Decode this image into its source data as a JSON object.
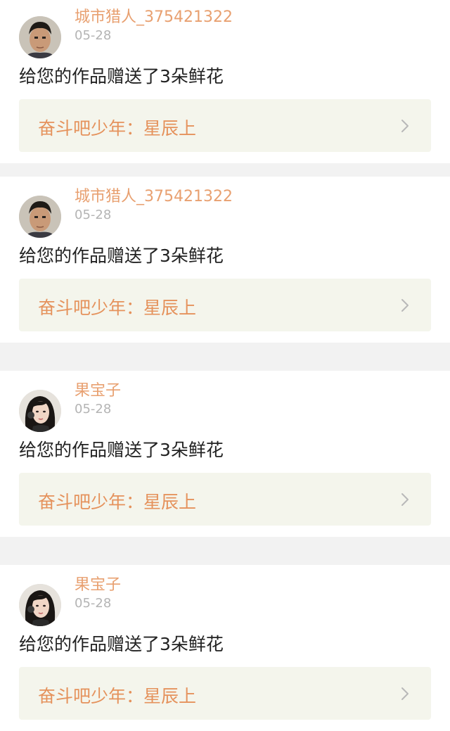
{
  "notifications": [
    {
      "avatar_icon": "male-user-avatar-icon",
      "username": "城市猎人_375421322",
      "date": "05-28",
      "message": "给您的作品赠送了3朵鲜花",
      "work_title": "奋斗吧少年：星辰上"
    },
    {
      "avatar_icon": "male-user-avatar-icon",
      "username": "城市猎人_375421322",
      "date": "05-28",
      "message": "给您的作品赠送了3朵鲜花",
      "work_title": "奋斗吧少年：星辰上"
    },
    {
      "avatar_icon": "female-user-avatar-icon",
      "username": "果宝子",
      "date": "05-28",
      "message": "给您的作品赠送了3朵鲜花",
      "work_title": "奋斗吧少年：星辰上"
    },
    {
      "avatar_icon": "female-user-avatar-icon",
      "username": "果宝子",
      "date": "05-28",
      "message": "给您的作品赠送了3朵鲜花",
      "work_title": "奋斗吧少年：星辰上"
    }
  ],
  "colors": {
    "username": "#e8a070",
    "date": "#b4b4b4",
    "message": "#222222",
    "work_title": "#e5925c",
    "link_background": "#f4f5ec",
    "separator": "#f2f2f2"
  },
  "icons": {
    "chevron": "chevron-right-icon"
  }
}
